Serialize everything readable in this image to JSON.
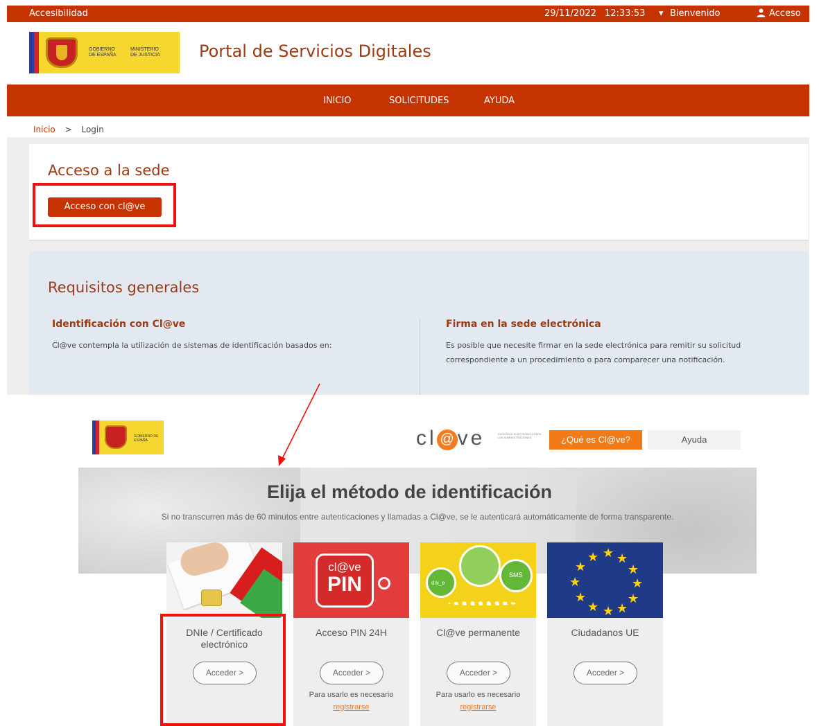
{
  "portal": {
    "top_bar": {
      "accessibility": "Accesibilidad",
      "date": "29/11/2022",
      "time": "12:33:53",
      "welcome": "Bienvenido",
      "access": "Acceso"
    },
    "logo": {
      "gobierno": "GOBIERNO DE ESPAÑA",
      "ministerio": "MINISTERIO DE JUSTICIA"
    },
    "title": "Portal de Servicios Digitales",
    "nav": [
      "INICIO",
      "SOLICITUDES",
      "AYUDA"
    ],
    "breadcrumb": {
      "home": "Inicio",
      "separator": ">",
      "current": "Login"
    },
    "access": {
      "title": "Acceso a la sede",
      "button": "Acceso con cl@ve"
    },
    "requirements": {
      "title": "Requisitos generales",
      "col1": {
        "heading": "Identificación con Cl@ve",
        "text": "Cl@ve contempla la utilización de sistemas de identificación basados en:"
      },
      "col2": {
        "heading": "Firma en la sede electrónica",
        "text": "Es posible que necesite firmar en la sede electrónica para remitir su solicitud correspondiente a un procedimiento o para comparecer una notificación."
      }
    }
  },
  "clave": {
    "logo_gobierno": "GOBIERNO DE ESPAÑA",
    "brand": {
      "cl": "cl",
      "at": "@",
      "ve": "ve",
      "tagline": "IDENTIDAD ELECTRÓNICA PARA LAS ADMINISTRACIONES"
    },
    "que_es": "¿Qué es Cl@ve?",
    "ayuda": "Ayuda",
    "hero_title": "Elija el método de identificación",
    "hero_sub": "Si no transcurren más de 60 minutos entre autenticaciones y llamadas a Cl@ve, se le autenticará automáticamente de forma transparente.",
    "methods": [
      {
        "label": "DNIe / Certificado electrónico",
        "button": "Acceder  >",
        "note": "",
        "link": ""
      },
      {
        "label": "Acceso PIN 24H",
        "button": "Acceder  >",
        "note": "Para usarlo es necesario",
        "link": "registrarse",
        "img_top": "cl@ve",
        "img_big": "PIN"
      },
      {
        "label": "Cl@ve permanente",
        "button": "Acceder  >",
        "note": "Para usarlo es necesario",
        "link": "registrarse",
        "img_sms": "SMS",
        "img_dni": "dni_e"
      },
      {
        "label": "Ciudadanos UE",
        "button": "Acceder  >",
        "note": "",
        "link": ""
      }
    ]
  },
  "colors": {
    "portal_red": "#c53400",
    "portal_title": "#9b3a14",
    "highlight": "#ee1111",
    "clave_orange": "#f27b17"
  },
  "icons": [
    "chevron-down-icon",
    "user-icon",
    "chevron-right-icon",
    "annotation-arrow-icon"
  ]
}
